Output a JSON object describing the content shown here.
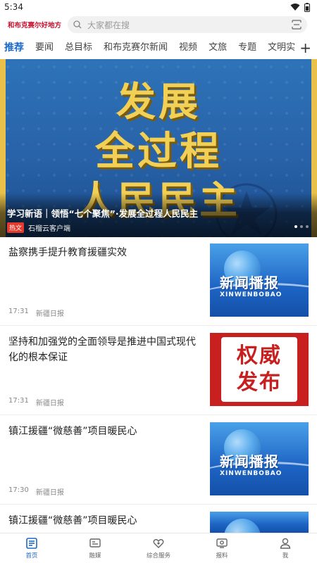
{
  "status_bar": {
    "time": "5:34"
  },
  "header": {
    "logo_text": "和布克赛尔好地方",
    "search_placeholder": "大家都在搜"
  },
  "tabs": [
    {
      "label": "推荐",
      "active": true
    },
    {
      "label": "要闻"
    },
    {
      "label": "总目标"
    },
    {
      "label": "和布克赛尔新闻"
    },
    {
      "label": "视频"
    },
    {
      "label": "文旅"
    },
    {
      "label": "专题"
    },
    {
      "label": "文明实"
    }
  ],
  "banner": {
    "title_lines": [
      "发展",
      "全过程",
      "人民民主"
    ],
    "caption": "学习新语｜领悟“七个聚焦”·发展全过程人民民主",
    "badge": "热文",
    "source": "石榴云客户端"
  },
  "news": [
    {
      "title": "盐察携手提升教育援疆实效",
      "time": "17:31",
      "source": "新疆日报",
      "thumb": "xwbb"
    },
    {
      "title": "坚持和加强党的全面领导是推进中国式现代化的根本保证",
      "time": "17:31",
      "source": "新疆日报",
      "thumb": "qwfb"
    },
    {
      "title": "镇江援疆“微慈善”项目暖民心",
      "time": "17:30",
      "source": "新疆日报",
      "thumb": "xwbb"
    },
    {
      "title": "镇江援疆“微慈善”项目暖民心",
      "time": "",
      "source": "",
      "thumb": "xwbb"
    }
  ],
  "thumbs": {
    "xwbb": {
      "cn": "新闻播报",
      "en": "XINWENBOBAO"
    },
    "qwfb": {
      "line1": "权威",
      "line2": "发布"
    }
  },
  "bottom_nav": [
    {
      "label": "首页",
      "icon": "home-news-icon",
      "active": true
    },
    {
      "label": "融媒",
      "icon": "media-icon"
    },
    {
      "label": "综合服务",
      "icon": "service-icon"
    },
    {
      "label": "报料",
      "icon": "report-icon"
    },
    {
      "label": "我",
      "icon": "profile-icon"
    }
  ],
  "colors": {
    "accent": "#1a68c8",
    "brand_red": "#c8102e",
    "banner_gold": "#f2cf55"
  }
}
